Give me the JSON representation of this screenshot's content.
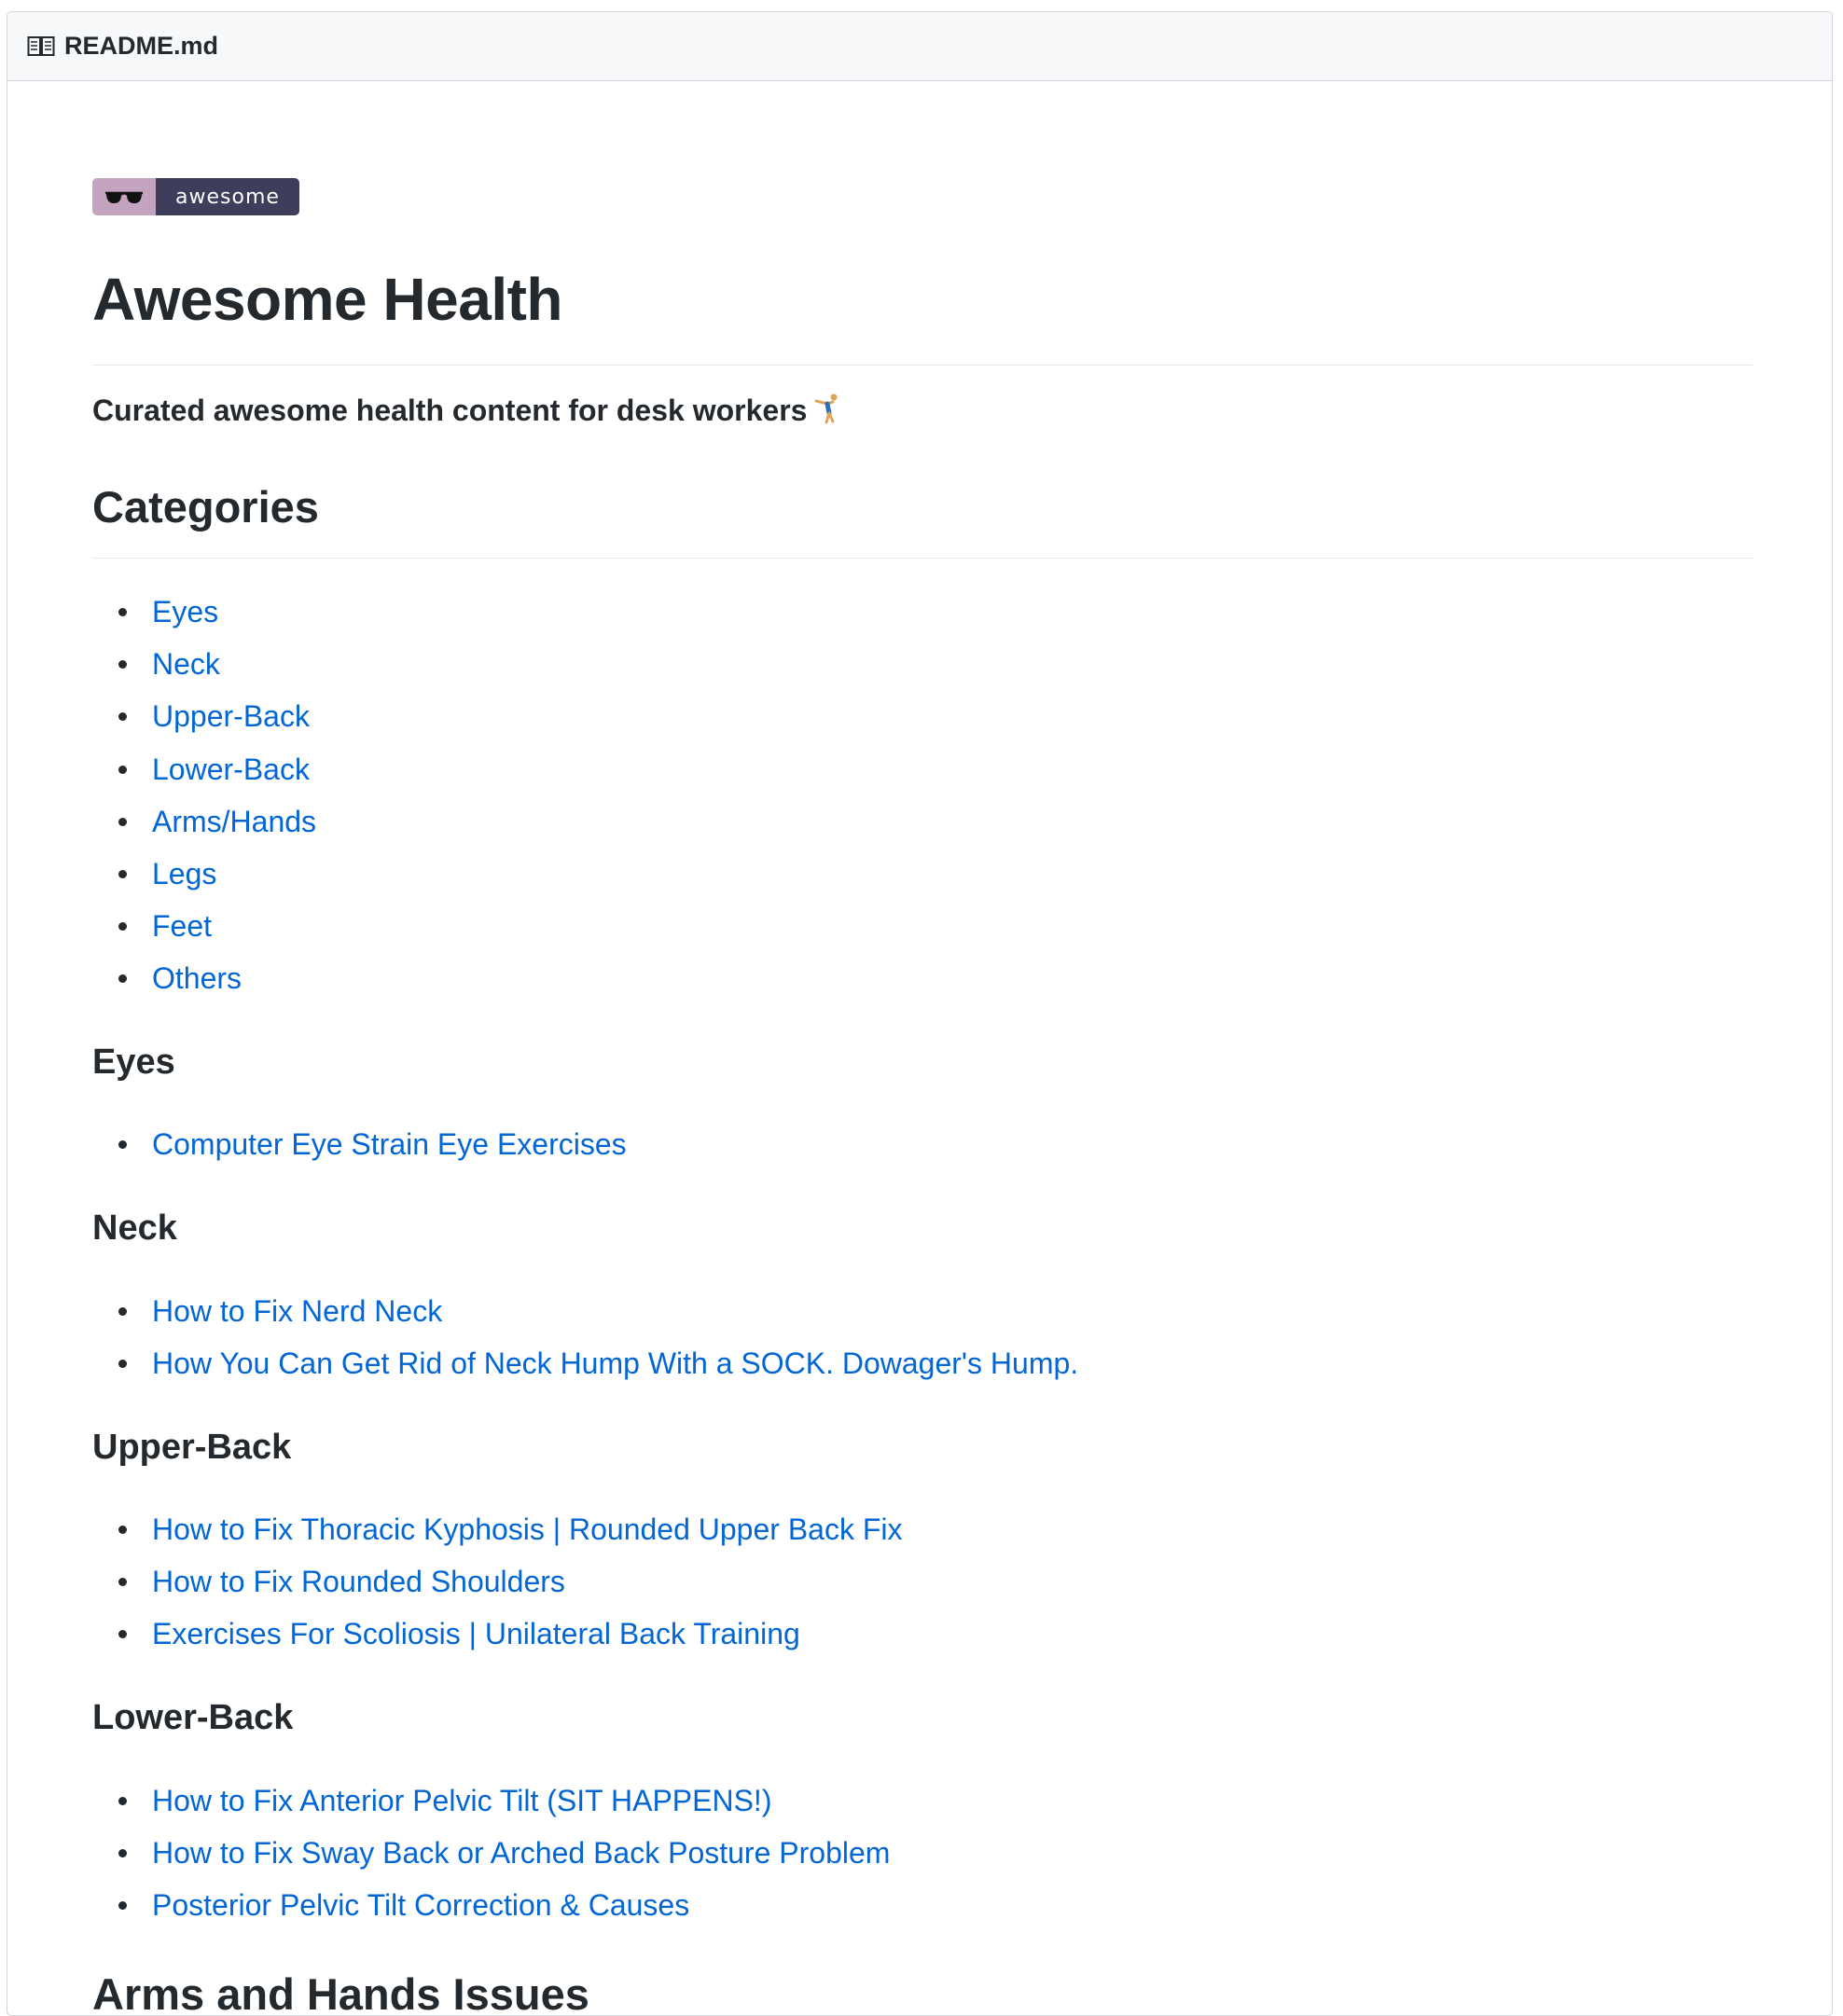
{
  "header": {
    "filename": "README.md",
    "icon": "book-icon"
  },
  "badge": {
    "icon": "sunglasses-icon",
    "label": "awesome"
  },
  "title": "Awesome Health",
  "tagline": "Curated awesome health content for desk workers",
  "tagline_icon": "gymnast-icon",
  "categories": {
    "heading": "Categories",
    "items": [
      "Eyes",
      "Neck",
      "Upper-Back",
      "Lower-Back",
      "Arms/Hands",
      "Legs",
      "Feet",
      "Others"
    ]
  },
  "sections": [
    {
      "heading": "Eyes",
      "links": [
        "Computer Eye Strain Eye Exercises"
      ]
    },
    {
      "heading": "Neck",
      "links": [
        "How to Fix Nerd Neck",
        "How You Can Get Rid of Neck Hump With a SOCK. Dowager's Hump."
      ]
    },
    {
      "heading": "Upper-Back",
      "links": [
        "How to Fix Thoracic Kyphosis | Rounded Upper Back Fix",
        "How to Fix Rounded Shoulders",
        "Exercises For Scoliosis | Unilateral Back Training"
      ]
    },
    {
      "heading": "Lower-Back",
      "links": [
        "How to Fix Anterior Pelvic Tilt (SIT HAPPENS!)",
        "How to Fix Sway Back or Arched Back Posture Problem",
        "Posterior Pelvic Tilt Correction & Causes"
      ]
    }
  ],
  "next_section": "Arms and Hands Issues",
  "colors": {
    "link": "#0366d6",
    "text": "#24292e",
    "header_bg": "#f6f8fa",
    "badge_left": "#c3a3bd",
    "badge_right": "#3f3d5c"
  }
}
